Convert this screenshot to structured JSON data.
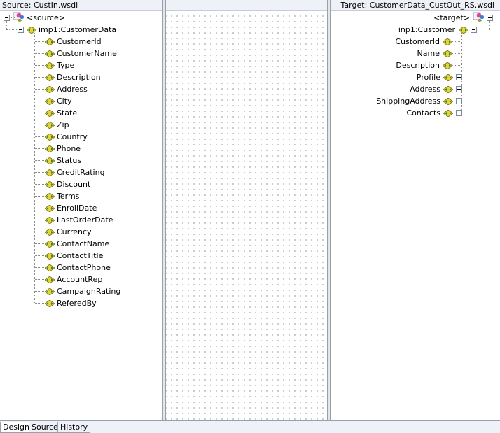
{
  "source": {
    "header": "Source: CustIn.wsdl",
    "root_label": "<source>",
    "element_label": "imp1:CustomerData",
    "fields": [
      "CustomerId",
      "CustomerName",
      "Type",
      "Description",
      "Address",
      "City",
      "State",
      "Zip",
      "Country",
      "Phone",
      "Status",
      "CreditRating",
      "Discount",
      "Terms",
      "EnrollDate",
      "LastOrderDate",
      "Currency",
      "ContactName",
      "ContactTitle",
      "ContactPhone",
      "AccountRep",
      "CampaignRating",
      "ReferedBy"
    ]
  },
  "target": {
    "header": "Target: CustomerData_CustOut_RS.wsdl",
    "root_label": "<target>",
    "element_label": "inp1:Customer",
    "fields": [
      {
        "label": "CustomerId",
        "expandable": false
      },
      {
        "label": "Name",
        "expandable": false
      },
      {
        "label": "Description",
        "expandable": false
      },
      {
        "label": "Profile",
        "expandable": true
      },
      {
        "label": "Address",
        "expandable": true
      },
      {
        "label": "ShippingAddress",
        "expandable": true
      },
      {
        "label": "Contacts",
        "expandable": true
      }
    ]
  },
  "tabs": [
    {
      "label": "Design",
      "active": true
    },
    {
      "label": "Source",
      "active": false
    },
    {
      "label": "History",
      "active": false
    }
  ],
  "colors": {
    "element_icon_fill": "#e6d23a",
    "element_icon_arrow": "#2d8f2d",
    "schema_icon_pink": "#d84aa0",
    "schema_icon_blue": "#3a7bd5"
  }
}
